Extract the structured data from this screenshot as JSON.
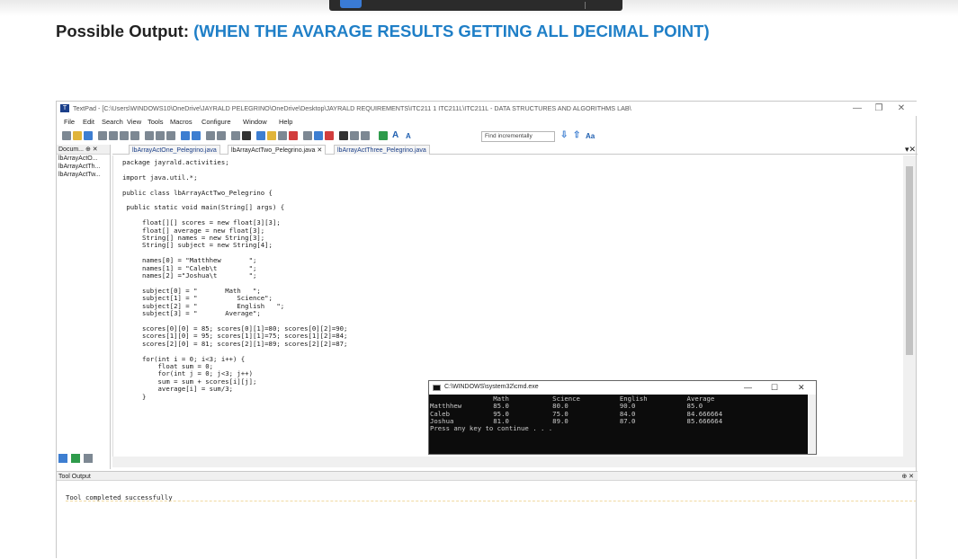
{
  "heading": {
    "prefix": "Possible Output: ",
    "highlight": "(WHEN THE AVARAGE RESULTS GETTING ALL DECIMAL POINT)"
  },
  "window": {
    "title": "TextPad - [C:\\Users\\WINDOWS10\\OneDrive\\JAYRALD PELEGRINO\\OneDrive\\Desktop\\JAYRALD REQUIREMENTS\\ITC211 1 ITC211L\\ITC211L - DATA STRUCTURES AND ALGORITHMS LAB\\",
    "menu": [
      "File",
      "Edit",
      "Search",
      "View",
      "Tools",
      "Macros",
      "Configure",
      "Window",
      "Help"
    ],
    "find_placeholder": "Find incrementally",
    "doc_panel_title": "Docum...",
    "documents": [
      "lbArrayActO...",
      "lbArrayActTh...",
      "lbArrayActTw..."
    ],
    "tabs": [
      "lbArrayActOne_Pelegrino.java",
      "lbArrayActTwo_Pelegrino.java",
      "lbArrayActThree_Pelegrino.java"
    ]
  },
  "code": [
    "package jayrald.activities;",
    "",
    "import java.util.*;",
    "",
    "public class lbArrayActTwo_Pelegrino {",
    "",
    " public static void main(String[] args) {",
    "",
    "     float[][] scores = new float[3][3];",
    "     float[] average = new float[3];",
    "     String[] names = new String[3];",
    "     String[] subject = new String[4];",
    "",
    "     names[0] = \"Matthhew       \";",
    "     names[1] = \"Caleb\\t        \";",
    "     names[2] =\"Joshua\\t        \";",
    "",
    "     subject[0] = \"       Math   \";",
    "     subject[1] = \"          Science\";",
    "     subject[2] = \"          English   \";",
    "     subject[3] = \"       Average\";",
    "",
    "     scores[0][0] = 85; scores[0][1]=80; scores[0][2]=90;",
    "     scores[1][0] = 95; scores[1][1]=75; scores[1][2]=84;",
    "     scores[2][0] = 81; scores[2][1]=89; scores[2][2]=87;",
    "",
    "     for(int i = 0; i<3; i++) {",
    "         float sum = 0;",
    "         for(int j = 0; j<3; j++)",
    "         sum = sum + scores[i][j];",
    "         average[i] = sum/3;",
    "     }"
  ],
  "cmd": {
    "title": "C:\\WINDOWS\\system32\\cmd.exe",
    "lines": [
      "                Math           Science          English          Average",
      "Matthhew        85.0           80.0             90.0             85.0",
      "Caleb           95.0           75.0             84.0             84.666664",
      "Joshua          81.0           89.0             87.0             85.666664",
      "Press any key to continue . . ."
    ]
  },
  "tool_output": {
    "title": "Tool Output",
    "message": "Tool completed successfully"
  }
}
